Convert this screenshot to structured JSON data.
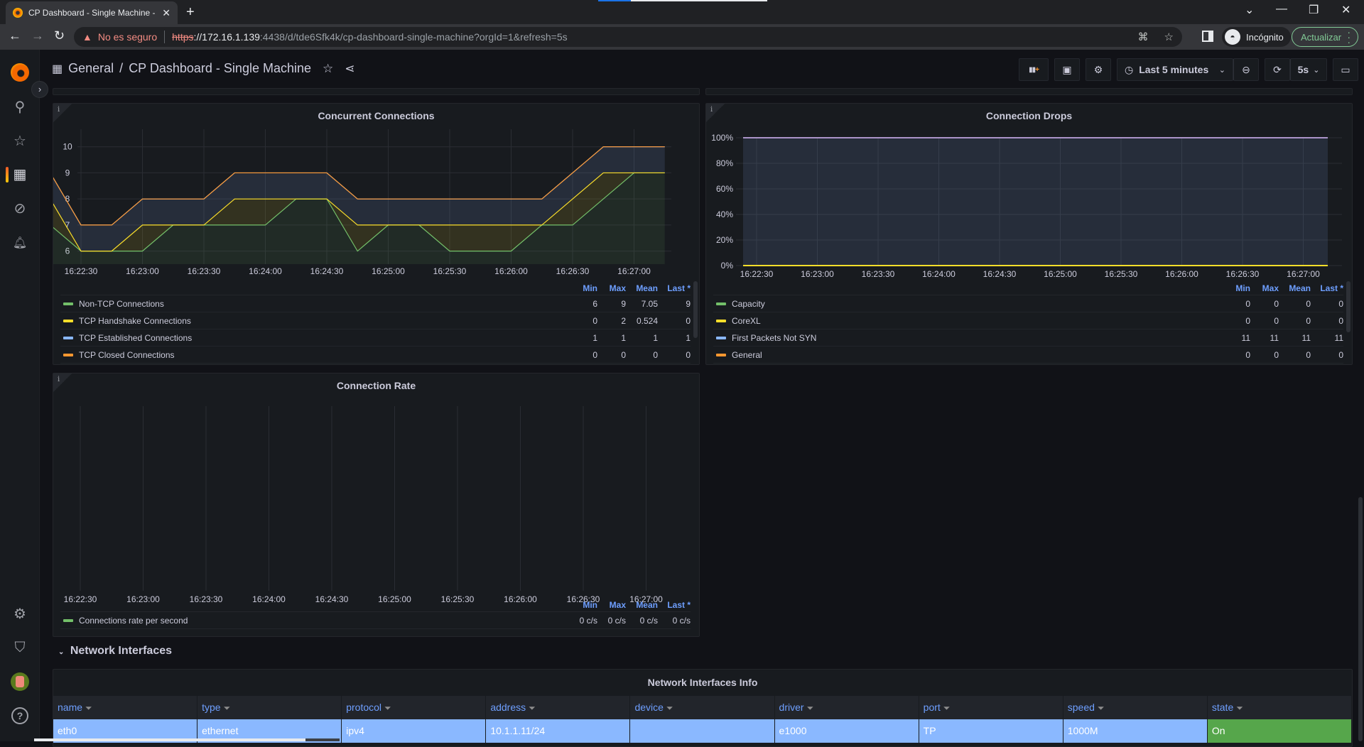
{
  "browser": {
    "tab_title": "CP Dashboard - Single Machine - Grafana",
    "tab_close": "✕",
    "new_tab": "+",
    "security_warning": "No es seguro",
    "url_scheme": "https",
    "url_host": "://172.16.1.139",
    "url_rest": ":4438/d/tde6Sfk4k/cp-dashboard-single-machine?orgId=1&refresh=5s",
    "incognito_label": "Incógnito",
    "update_label": "Actualizar",
    "window_controls": {
      "tabsearch": "⌄",
      "minimize": "—",
      "restore": "❐",
      "close": "✕"
    },
    "nav": {
      "back": "←",
      "forward": "→",
      "reload": "↻"
    }
  },
  "sidebar": {
    "items": [
      {
        "name": "home-logo",
        "icon": "grafana-logo"
      },
      {
        "name": "search",
        "icon": "search-icon",
        "glyph": "⚲"
      },
      {
        "name": "starred",
        "icon": "star-icon",
        "glyph": "☆"
      },
      {
        "name": "dashboards",
        "icon": "dashboards-icon",
        "glyph": "▦",
        "active": true
      },
      {
        "name": "explore",
        "icon": "compass-icon",
        "glyph": "⊘"
      },
      {
        "name": "alerting",
        "icon": "bell-icon",
        "glyph": "🔔︎"
      },
      {
        "name": "configuration",
        "icon": "gear-icon",
        "glyph": "⚙"
      },
      {
        "name": "server-admin",
        "icon": "shield-icon",
        "glyph": "⛉"
      },
      {
        "name": "profile",
        "icon": "avatar"
      },
      {
        "name": "help",
        "icon": "help-icon",
        "glyph": "?"
      }
    ],
    "expand_glyph": "›"
  },
  "dashnav": {
    "folder": "General",
    "separator": "/",
    "title": "CP Dashboard - Single Machine",
    "star_glyph": "☆",
    "share_glyph": "⋖",
    "toolbar": {
      "add_panel_glyph": "▮▮+",
      "save_glyph": "💾︎",
      "settings_glyph": "⚙",
      "time_range_icon": "◷",
      "time_range_label": "Last 5 minutes",
      "zoom_out_glyph": "⊖",
      "refresh_glyph": "⟳",
      "refresh_interval": "5s",
      "chevron": "⌄",
      "tv_mode_glyph": "▭"
    }
  },
  "panels": {
    "concurrent": {
      "title": "Concurrent Connections",
      "info": "i",
      "legend_headers": [
        "Min",
        "Max",
        "Mean",
        "Last *"
      ],
      "legend": [
        {
          "name": "Non-TCP Connections",
          "color": "#73bf69",
          "min": "6",
          "max": "9",
          "mean": "7.05",
          "last": "9"
        },
        {
          "name": "TCP Handshake Connections",
          "color": "#fade2a",
          "min": "0",
          "max": "2",
          "mean": "0.524",
          "last": "0"
        },
        {
          "name": "TCP Established Connections",
          "color": "#8ab8ff",
          "min": "1",
          "max": "1",
          "mean": "1",
          "last": "1"
        },
        {
          "name": "TCP Closed Connections",
          "color": "#ff9830",
          "min": "0",
          "max": "0",
          "mean": "0",
          "last": "0"
        }
      ]
    },
    "drops": {
      "title": "Connection Drops",
      "info": "i",
      "legend_headers": [
        "Min",
        "Max",
        "Mean",
        "Last *"
      ],
      "legend": [
        {
          "name": "Capacity",
          "color": "#73bf69",
          "min": "0",
          "max": "0",
          "mean": "0",
          "last": "0"
        },
        {
          "name": "CoreXL",
          "color": "#fade2a",
          "min": "0",
          "max": "0",
          "mean": "0",
          "last": "0"
        },
        {
          "name": "First Packets Not SYN",
          "color": "#8ab8ff",
          "min": "11",
          "max": "11",
          "mean": "11",
          "last": "11"
        },
        {
          "name": "General",
          "color": "#ff9830",
          "min": "0",
          "max": "0",
          "mean": "0",
          "last": "0"
        }
      ]
    },
    "rate": {
      "title": "Connection Rate",
      "info": "i",
      "legend_headers": [
        "Min",
        "Max",
        "Mean",
        "Last *"
      ],
      "legend": [
        {
          "name": "Connections rate per second",
          "color": "#73bf69",
          "min": "0 c/s",
          "max": "0 c/s",
          "mean": "0 c/s",
          "last": "0 c/s"
        }
      ]
    }
  },
  "row": {
    "chevron": "⌄",
    "title": "Network Interfaces"
  },
  "table": {
    "title": "Network Interfaces Info",
    "filter_glyph": "⏷",
    "columns": [
      "name",
      "type",
      "protocol",
      "address",
      "device",
      "driver",
      "port",
      "speed",
      "state"
    ],
    "rows": [
      [
        "eth0",
        "ethernet",
        "ipv4",
        "10.1.1.11/24",
        "",
        "e1000",
        "TP",
        "1000M",
        "On"
      ]
    ],
    "state_color": "#56a64b",
    "row_color": "#8ab8ff"
  },
  "chart_data": [
    {
      "type": "area",
      "title": "Concurrent Connections",
      "stacked": true,
      "x": [
        "16:22:15",
        "16:22:30",
        "16:22:45",
        "16:23:00",
        "16:23:15",
        "16:23:30",
        "16:23:45",
        "16:24:00",
        "16:24:15",
        "16:24:30",
        "16:24:45",
        "16:25:00",
        "16:25:15",
        "16:25:30",
        "16:25:45",
        "16:26:00",
        "16:26:15",
        "16:26:30",
        "16:26:45",
        "16:27:00",
        "16:27:15"
      ],
      "x_ticks": [
        "16:22:30",
        "16:23:00",
        "16:23:30",
        "16:24:00",
        "16:24:30",
        "16:25:00",
        "16:25:30",
        "16:26:00",
        "16:26:30",
        "16:27:00"
      ],
      "y_ticks": [
        6,
        7,
        8,
        9,
        10
      ],
      "ylim": [
        5.5,
        10.4
      ],
      "series": [
        {
          "name": "Non-TCP Connections",
          "color": "#73bf69",
          "values": [
            7,
            6,
            6,
            6,
            7,
            7,
            7,
            7,
            8,
            8,
            6,
            7,
            7,
            6,
            6,
            6,
            7,
            7,
            8,
            9,
            9
          ]
        },
        {
          "name": "TCP Handshake Connections",
          "color": "#fade2a",
          "values": [
            1,
            0,
            0,
            1,
            0,
            0,
            1,
            1,
            0,
            0,
            1,
            0,
            0,
            1,
            1,
            1,
            0,
            1,
            1,
            0,
            0
          ]
        },
        {
          "name": "TCP Established Connections",
          "color": "#8ab8ff",
          "values": [
            1,
            1,
            1,
            1,
            1,
            1,
            1,
            1,
            1,
            1,
            1,
            1,
            1,
            1,
            1,
            1,
            1,
            1,
            1,
            1,
            1
          ]
        },
        {
          "name": "TCP Closed Connections",
          "color": "#ff9830",
          "values": [
            0,
            0,
            0,
            0,
            0,
            0,
            0,
            0,
            0,
            0,
            0,
            0,
            0,
            0,
            0,
            0,
            0,
            0,
            0,
            0,
            0
          ]
        }
      ],
      "grid": true,
      "legend": "bottom"
    },
    {
      "type": "area",
      "title": "Connection Drops",
      "stacked": true,
      "percent": true,
      "x_ticks": [
        "16:22:30",
        "16:23:00",
        "16:23:30",
        "16:24:00",
        "16:24:30",
        "16:25:00",
        "16:25:30",
        "16:26:00",
        "16:26:30",
        "16:27:00"
      ],
      "y_ticks": [
        "0%",
        "20%",
        "40%",
        "60%",
        "80%",
        "100%"
      ],
      "ylim": [
        0,
        100
      ],
      "series": [
        {
          "name": "Capacity",
          "color": "#73bf69",
          "values_percent": [
            0,
            0
          ]
        },
        {
          "name": "CoreXL",
          "color": "#fade2a",
          "values_percent": [
            0,
            0
          ]
        },
        {
          "name": "First Packets Not SYN",
          "color": "#8ab8ff",
          "values_percent": [
            100,
            100
          ]
        },
        {
          "name": "General",
          "color": "#ff9830",
          "values_percent": [
            0,
            0
          ]
        }
      ],
      "grid": true,
      "legend": "bottom"
    },
    {
      "type": "line",
      "title": "Connection Rate",
      "x_ticks": [
        "16:22:30",
        "16:23:00",
        "16:23:30",
        "16:24:00",
        "16:24:30",
        "16:25:00",
        "16:25:30",
        "16:26:00",
        "16:26:30",
        "16:27:00"
      ],
      "series": [
        {
          "name": "Connections rate per second",
          "color": "#73bf69",
          "values": []
        }
      ],
      "grid": true,
      "legend": "bottom"
    }
  ]
}
